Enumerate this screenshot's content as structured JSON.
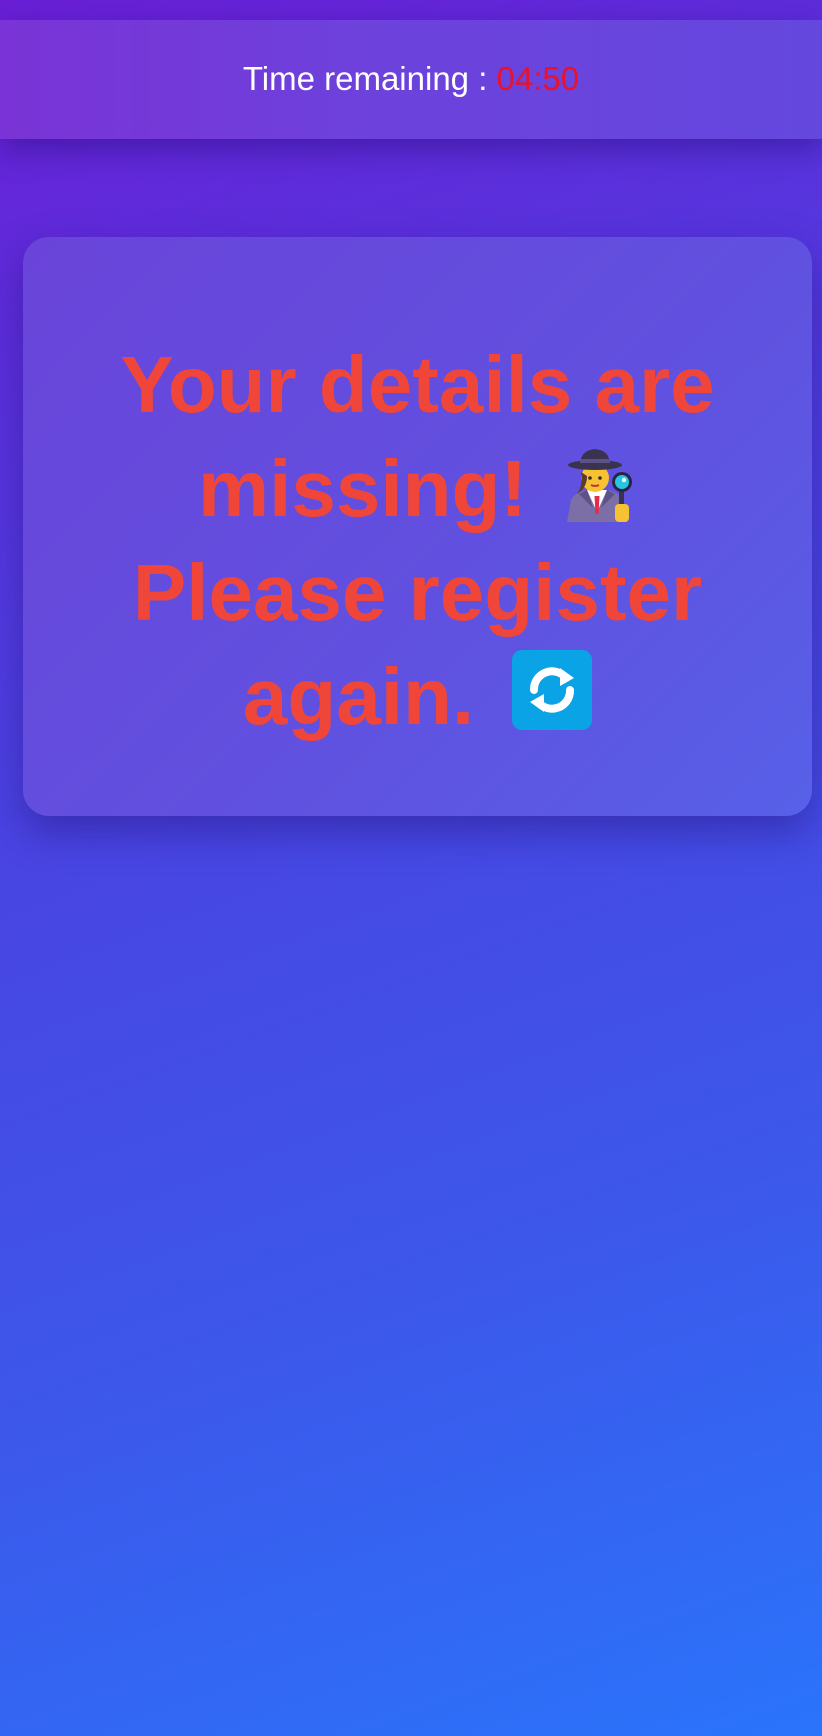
{
  "timer": {
    "label": "Time remaining :",
    "value": "04:50",
    "label_color": "#ffffff",
    "value_color": "#e8122e"
  },
  "message": {
    "line1": "Your details are",
    "line2": "missing!",
    "line3": "Please register",
    "line4": "again.",
    "color": "#f0463a",
    "emoji_missing": "woman-detective-icon",
    "emoji_register": "refresh-arrows-icon"
  },
  "colors": {
    "background_start": "#6a1fd6",
    "background_end": "#2a74fb",
    "card": "#6150df",
    "refresh_badge": "#0aa3e6"
  }
}
